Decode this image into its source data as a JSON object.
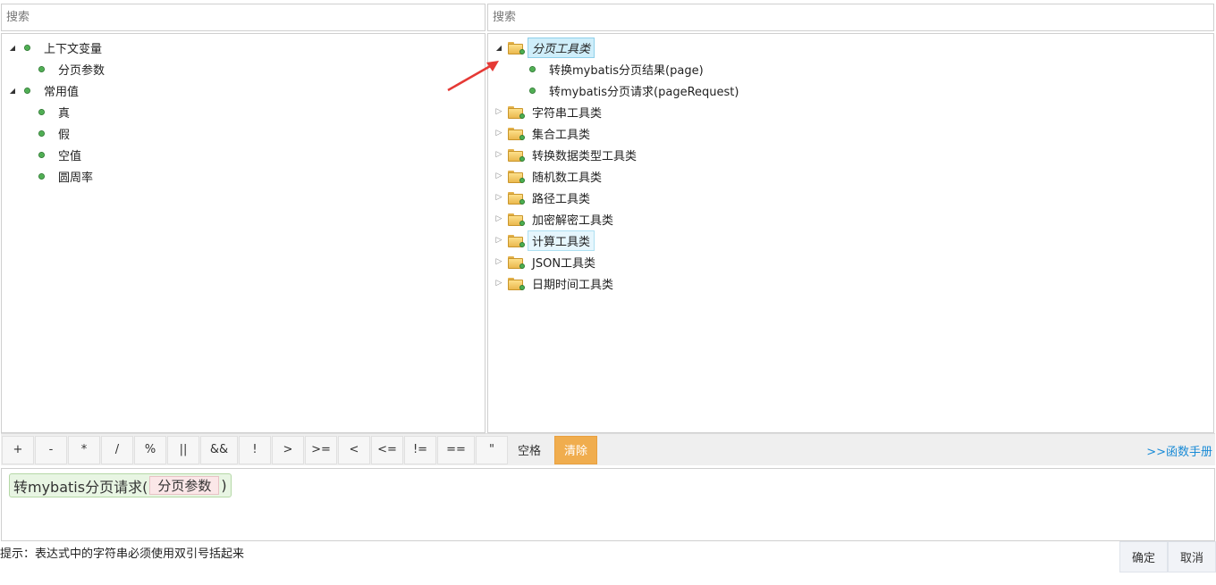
{
  "left_search": {
    "placeholder": "搜索"
  },
  "right_search": {
    "placeholder": "搜索"
  },
  "left_tree": {
    "groups": [
      {
        "label": "上下文变量",
        "children": [
          "分页参数"
        ]
      },
      {
        "label": "常用值",
        "children": [
          "真",
          "假",
          "空值",
          "圆周率"
        ]
      }
    ]
  },
  "right_tree": {
    "expanded": {
      "label": "分页工具类",
      "children": [
        "转换mybatis分页结果(page)",
        "转mybatis分页请求(pageRequest)"
      ]
    },
    "collapsed": [
      "字符串工具类",
      "集合工具类",
      "转换数据类型工具类",
      "随机数工具类",
      "路径工具类",
      "加密解密工具类",
      "计算工具类",
      "JSON工具类",
      "日期时间工具类"
    ]
  },
  "toolbar": {
    "operators": [
      "+",
      "-",
      "*",
      "/",
      "%",
      "||",
      "&&",
      "!",
      ">",
      ">=",
      "<",
      "<=",
      "!=",
      "==",
      "\""
    ],
    "space_label": "空格",
    "clear_label": "清除",
    "manual_link": ">>函数手册"
  },
  "expression": {
    "function_prefix": "转mybatis分页请求(",
    "param": "分页参数",
    "suffix": ")"
  },
  "hint": "提示：表达式中的字符串必须使用双引号括起来",
  "footer": {
    "ok_label": "确定",
    "cancel_label": "取消"
  },
  "colors": {
    "clear_button": "#f0ad4e",
    "link": "#1a8bd6",
    "node_dot": "#4caf50",
    "selected_bg": "#cfeefa",
    "arrow": "#e53935"
  }
}
